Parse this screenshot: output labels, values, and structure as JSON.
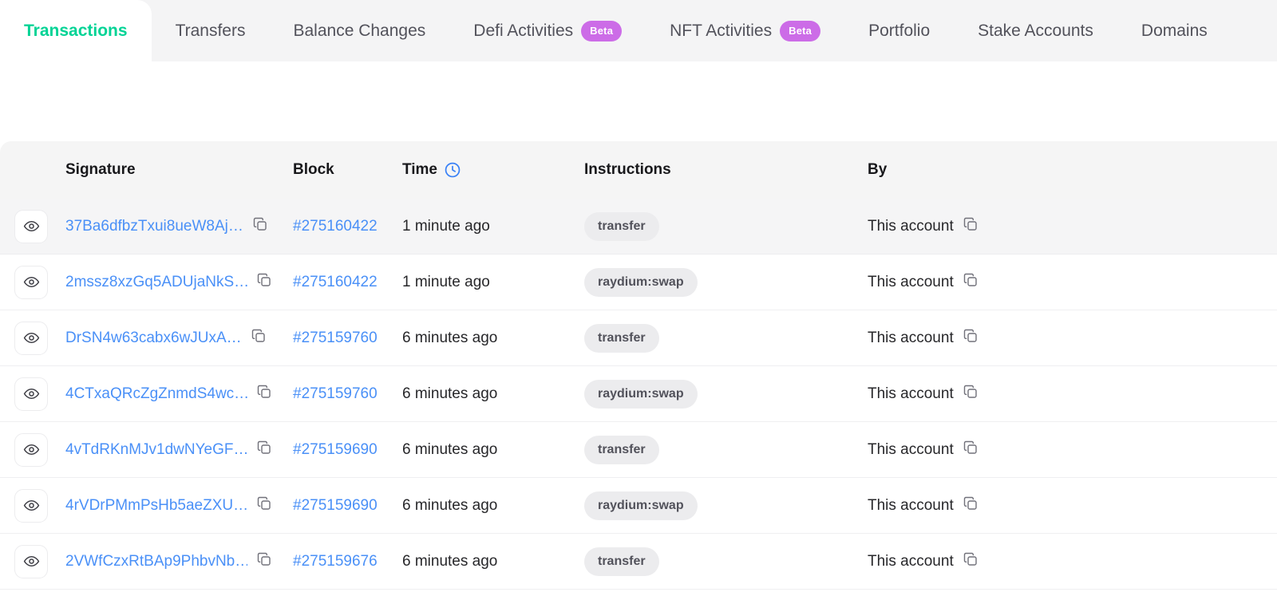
{
  "tabs": [
    {
      "label": "Transactions",
      "active": true,
      "badge": null
    },
    {
      "label": "Transfers",
      "active": false,
      "badge": null
    },
    {
      "label": "Balance Changes",
      "active": false,
      "badge": null
    },
    {
      "label": "Defi Activities",
      "active": false,
      "badge": "Beta"
    },
    {
      "label": "NFT Activities",
      "active": false,
      "badge": "Beta"
    },
    {
      "label": "Portfolio",
      "active": false,
      "badge": null
    },
    {
      "label": "Stake Accounts",
      "active": false,
      "badge": null
    },
    {
      "label": "Domains",
      "active": false,
      "badge": null
    }
  ],
  "table": {
    "columns": {
      "signature": "Signature",
      "block": "Block",
      "time": "Time",
      "instructions": "Instructions",
      "by": "By"
    },
    "time_icon": "clock-icon",
    "row_icon": "eye-icon",
    "copy_icon": "copy-icon",
    "rows": [
      {
        "signature": "37Ba6dfbzTxui8ueW8Aj…",
        "block": "#275160422",
        "time": "1 minute ago",
        "instruction": "transfer",
        "by": "This account",
        "hovered": true
      },
      {
        "signature": "2mssz8xzGq5ADUjaNkS…",
        "block": "#275160422",
        "time": "1 minute ago",
        "instruction": "raydium:swap",
        "by": "This account",
        "hovered": false
      },
      {
        "signature": "DrSN4w63cabx6wJUxA…",
        "block": "#275159760",
        "time": "6 minutes ago",
        "instruction": "transfer",
        "by": "This account",
        "hovered": false
      },
      {
        "signature": "4CTxaQRcZgZnmdS4wc…",
        "block": "#275159760",
        "time": "6 minutes ago",
        "instruction": "raydium:swap",
        "by": "This account",
        "hovered": false
      },
      {
        "signature": "4vTdRKnMJv1dwNYeGF…",
        "block": "#275159690",
        "time": "6 minutes ago",
        "instruction": "transfer",
        "by": "This account",
        "hovered": false
      },
      {
        "signature": "4rVDrPMmPsHb5aeZXU…",
        "block": "#275159690",
        "time": "6 minutes ago",
        "instruction": "raydium:swap",
        "by": "This account",
        "hovered": false
      },
      {
        "signature": "2VWfCzxRtBAp9PhbvNb…",
        "block": "#275159676",
        "time": "6 minutes ago",
        "instruction": "transfer",
        "by": "This account",
        "hovered": false
      }
    ]
  },
  "colors": {
    "active_tab_text": "#00d395",
    "beta_badge": "#cc6ce7",
    "link": "#4a90f7",
    "clock": "#3b82f6",
    "header_bg": "#f5f5f5",
    "tabbar_bg": "#f4f4f5"
  }
}
